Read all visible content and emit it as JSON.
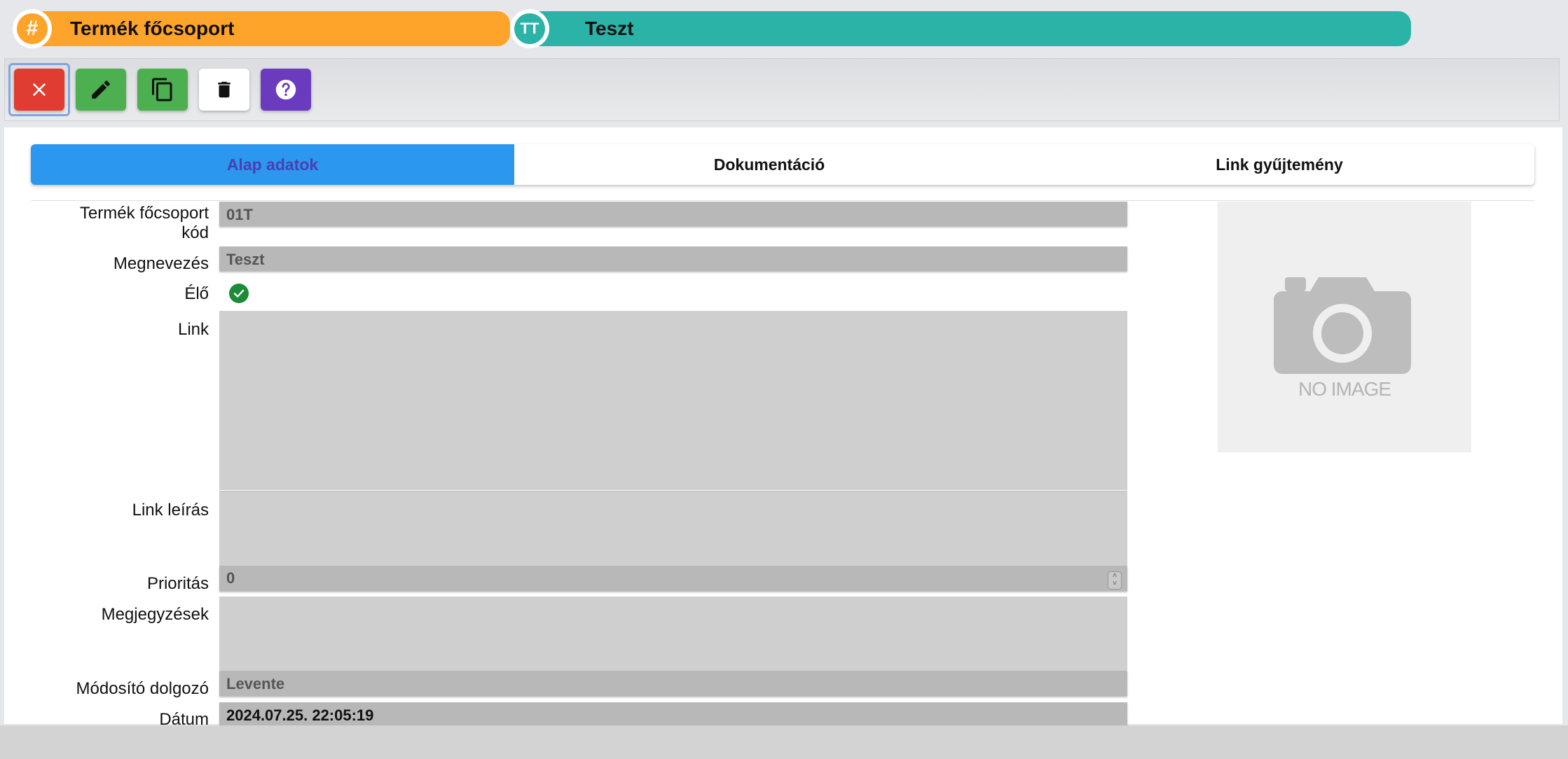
{
  "header": {
    "category": {
      "icon": "hash-icon",
      "label": "Termék főcsoport",
      "color": "#ffa42b"
    },
    "name": {
      "icon": "text-format-icon",
      "icon_text": "TT",
      "label": "Teszt",
      "color": "#2bb3a8"
    }
  },
  "toolbar": {
    "buttons": [
      {
        "name": "close",
        "icon": "close-icon",
        "color": "#e03c31"
      },
      {
        "name": "edit",
        "icon": "pencil-icon",
        "color": "#4caf50"
      },
      {
        "name": "copy",
        "icon": "copy-icon",
        "color": "#4caf50"
      },
      {
        "name": "delete",
        "icon": "trash-icon",
        "color": "#ffffff"
      },
      {
        "name": "help",
        "icon": "help-icon",
        "color": "#6a3bbf"
      }
    ]
  },
  "tabs": [
    {
      "label": "Alap adatok",
      "active": true
    },
    {
      "label": "Dokumentáció",
      "active": false
    },
    {
      "label": "Link gyűjtemény",
      "active": false
    }
  ],
  "form": {
    "code_label_1": "Termék főcsoport",
    "code_label_2": "kód",
    "code_value": "01T",
    "name_label": "Megnevezés",
    "name_value": "Teszt",
    "live_label": "Élő",
    "live_checked": true,
    "link_label": "Link",
    "link_value": "",
    "link_desc_label": "Link leírás",
    "link_desc_value": "",
    "priority_label": "Prioritás",
    "priority_value": "0",
    "notes_label": "Megjegyzések",
    "notes_value": "",
    "modifier_label": "Módosító dolgozó",
    "modifier_value": "Levente",
    "date_label": "Dátum",
    "date_value": "2024.07.25. 22:05:19"
  },
  "image": {
    "placeholder_text": "NO IMAGE",
    "icon": "camera-icon"
  }
}
